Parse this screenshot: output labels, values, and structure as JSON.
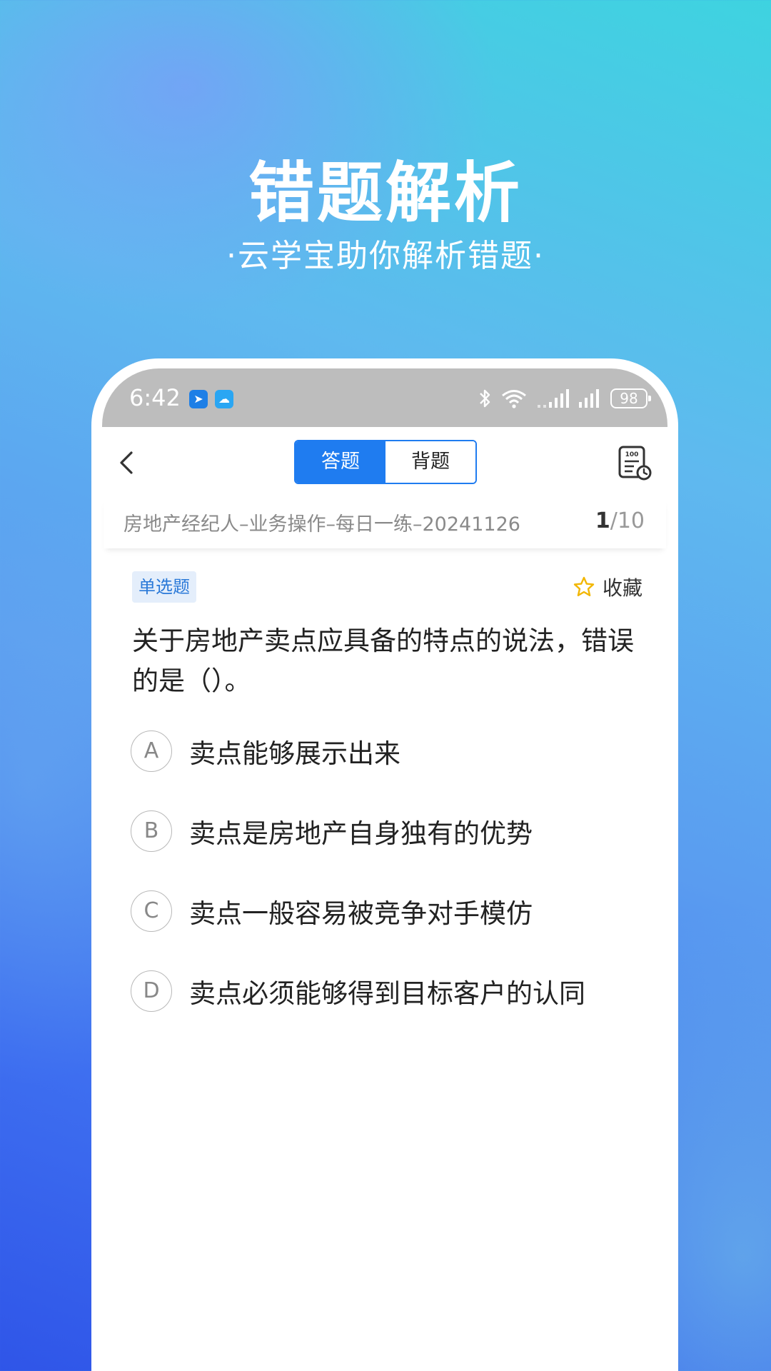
{
  "hero": {
    "title": "错题解析",
    "subtitle": "·云学宝助你解析错题·"
  },
  "status_bar": {
    "time": "6:42",
    "battery": "98"
  },
  "nav": {
    "tabs": [
      {
        "label": "答题",
        "active": true
      },
      {
        "label": "背题",
        "active": false
      }
    ]
  },
  "exam": {
    "name": "房地产经纪人–业务操作–每日一练–20241126",
    "current": "1",
    "total": "/10"
  },
  "question": {
    "type": "单选题",
    "favorite_label": "收藏",
    "text": "关于房地产卖点应具备的特点的说法，错误的是（）。",
    "options": [
      {
        "letter": "A",
        "text": "卖点能够展示出来"
      },
      {
        "letter": "B",
        "text": "卖点是房地产自身独有的优势"
      },
      {
        "letter": "C",
        "text": "卖点一般容易被竞争对手模仿"
      },
      {
        "letter": "D",
        "text": "卖点必须能够得到目标客户的认同"
      }
    ]
  },
  "colors": {
    "accent": "#1f7cf0",
    "tag_bg": "#e4eefb",
    "star": "#f2b705"
  }
}
